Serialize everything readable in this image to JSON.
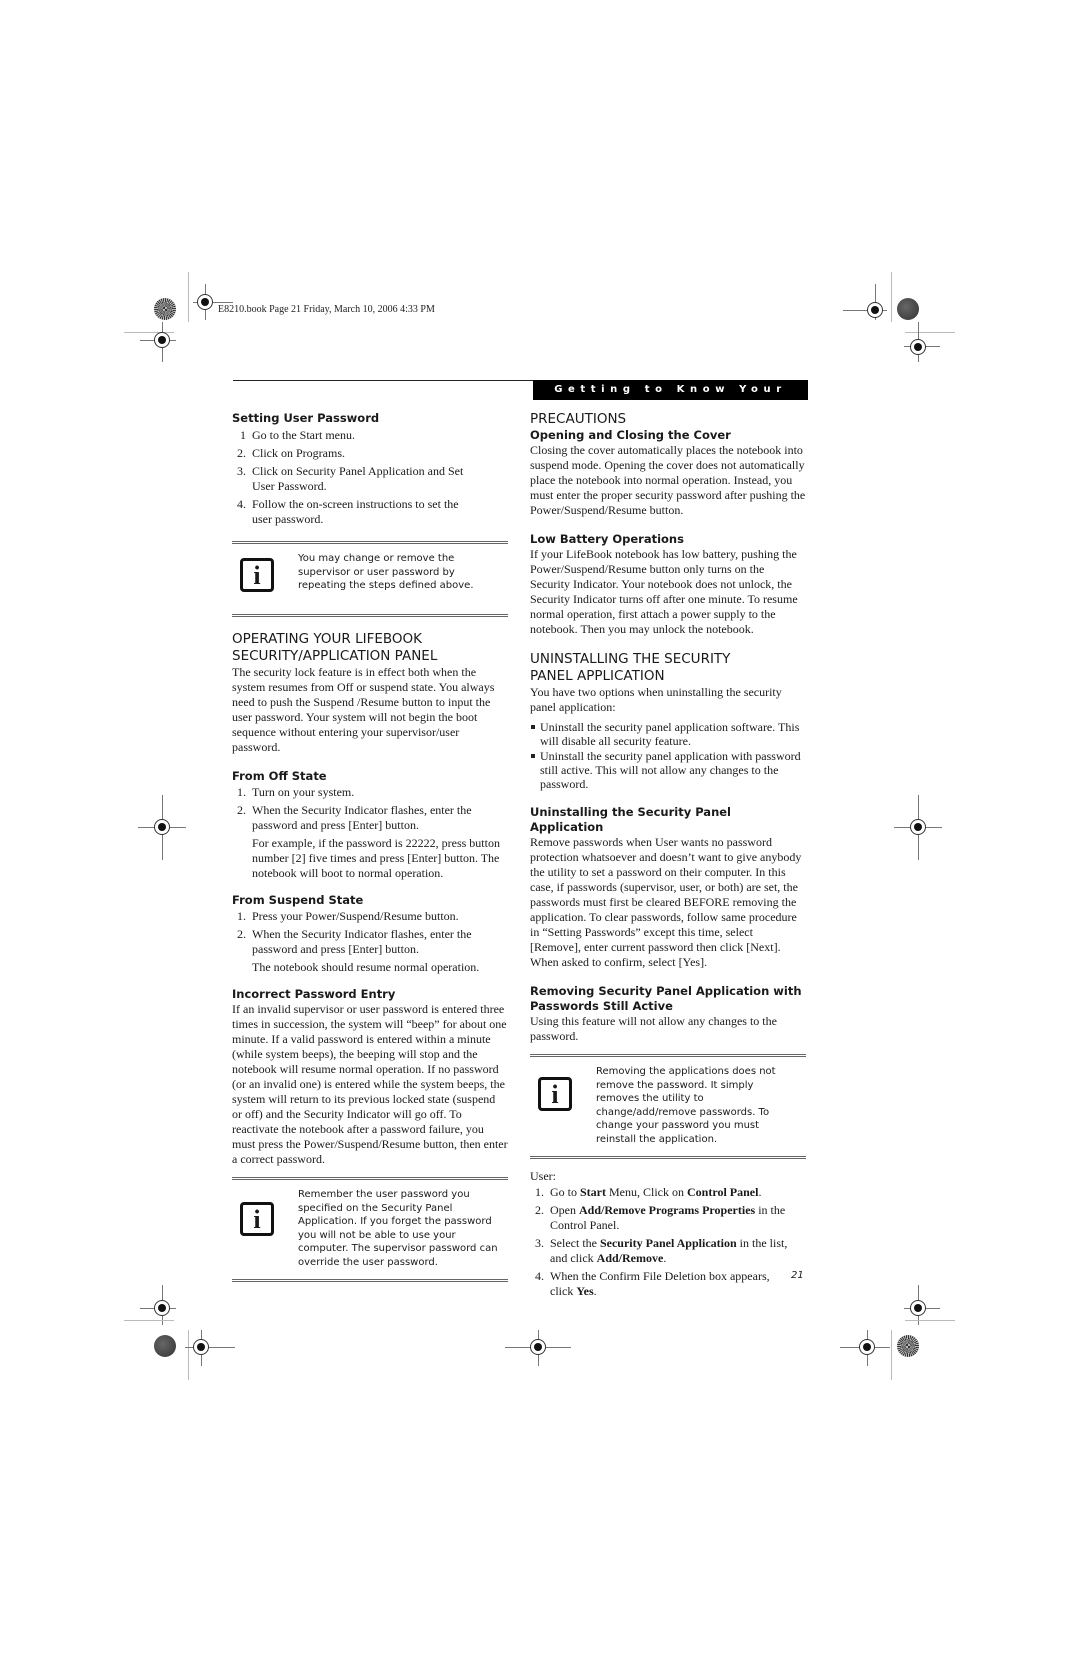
{
  "slug": "E8210.book  Page 21  Friday, March 10, 2006  4:33 PM",
  "header": {
    "banner": "Getting to Know Your LifeBook"
  },
  "left": {
    "setting_user_password": {
      "title": "Setting User Password",
      "steps": [
        {
          "n": "1",
          "text": "Go to the Start menu."
        },
        {
          "n": "2.",
          "text": "Click on Programs."
        },
        {
          "n": "3.",
          "text": "Click on Security Panel Application and Set User Password."
        },
        {
          "n": "4.",
          "text": "Follow the on-screen instructions to set the user password."
        }
      ]
    },
    "note1": {
      "icon": "info-icon",
      "text": "You may change or remove the supervisor or user password by repeating the steps defined above."
    },
    "operating": {
      "title_line1": "OPERATING YOUR LIFEBOOK",
      "title_line2": "SECURITY/APPLICATION PANEL",
      "body": "The security lock feature is in effect both when the system resumes from Off or suspend state. You always need to push the Suspend /Resume button to input the user password. Your system will not begin the boot sequence without entering your supervisor/user password."
    },
    "from_off": {
      "title": "From Off State",
      "steps": [
        {
          "n": "1.",
          "text": "Turn on your system."
        },
        {
          "n": "2.",
          "text": "When the Security Indicator flashes, enter the password and press [Enter] button.",
          "extra": "For example, if the password is 22222, press button number [2] five times and press [Enter] button. The notebook will boot to normal operation."
        }
      ]
    },
    "from_suspend": {
      "title": "From Suspend State",
      "steps": [
        {
          "n": "1.",
          "text": "Press your Power/Suspend/Resume button."
        },
        {
          "n": "2.",
          "text": "When the Security Indicator flashes, enter the password and press [Enter] button.",
          "extra": "The notebook should resume normal operation."
        }
      ]
    },
    "incorrect": {
      "title": "Incorrect Password Entry",
      "body": "If an invalid supervisor or user password is entered three times in succession, the system will “beep” for about one minute. If a valid password is entered within a minute (while system beeps), the beeping will stop and the notebook will resume normal operation. If no password (or an invalid one) is entered while the system beeps, the system will return to its previous locked state (suspend or off) and the Security Indicator will go off. To reactivate the notebook after a password failure, you must press the Power/Suspend/Resume button, then enter a correct password."
    },
    "note2": {
      "icon": "info-icon",
      "text": "Remember the user password you specified on the Security Panel Application. If you forget the password you will not be able to use your computer. The supervisor password can override the user password."
    }
  },
  "right": {
    "precautions": {
      "title": "PRECAUTIONS"
    },
    "opening": {
      "title": "Opening and Closing the Cover",
      "body": "Closing the cover automatically places the notebook into suspend mode. Opening the cover does not automatically place the notebook into normal operation. Instead, you must enter the proper security password after pushing the Power/Suspend/Resume button."
    },
    "low_battery": {
      "title": "Low Battery Operations",
      "body": "If your LifeBook notebook has low battery, pushing the Power/Suspend/Resume button only turns on the Security Indicator. Your notebook does not unlock, the Security Indicator turns off after one minute. To resume normal operation, first attach a power supply to the notebook. Then you may unlock the notebook."
    },
    "uninstalling": {
      "title_line1": "UNINSTALLING THE SECURITY",
      "title_line2": "PANEL APPLICATION",
      "body": "You have two options when uninstalling the security panel application:",
      "bullets": [
        "Uninstall the security panel application software. This will disable all security feature.",
        "Uninstall the security panel application with password still active. This will not allow any changes to the password."
      ]
    },
    "uninstall_app": {
      "title": "Uninstalling the Security Panel Application",
      "body": "Remove passwords when User wants no password protection whatsoever and doesn’t want to give anybody the utility to set a password on their computer. In this case, if passwords (supervisor, user, or both) are set, the passwords must first be cleared BEFORE removing the application. To clear passwords, follow same procedure in “Setting Passwords” except this time, select [Remove], enter current password then click [Next]. When asked to confirm, select [Yes]."
    },
    "removing": {
      "title_line1": "Removing Security Panel Application with",
      "title_line2": "Passwords Still Active",
      "body": "Using this feature will not allow any changes to the password."
    },
    "note3": {
      "icon": "info-icon",
      "text": "Removing the applications does not remove the password. It simply removes the utility to change/add/remove passwords. To change your password you must reinstall the application."
    },
    "user": {
      "label": "User:",
      "steps": [
        {
          "n": "1.",
          "pre": "Go to ",
          "b1": "Start",
          "mid": " Menu, Click on ",
          "b2": "Control Panel",
          "post": "."
        },
        {
          "n": "2.",
          "pre": "Open ",
          "b1": "Add/Remove Programs Properties",
          "mid": " in the Control Panel.",
          "b2": "",
          "post": ""
        },
        {
          "n": "3.",
          "pre": "Select the ",
          "b1": "Security Panel Application",
          "mid": " in the list, and click ",
          "b2": "Add/Remove",
          "post": "."
        },
        {
          "n": "4.",
          "pre": "When the Confirm File Deletion box appears, click ",
          "b1": "Yes",
          "mid": ".",
          "b2": "",
          "post": ""
        }
      ]
    }
  },
  "page_number": "21"
}
